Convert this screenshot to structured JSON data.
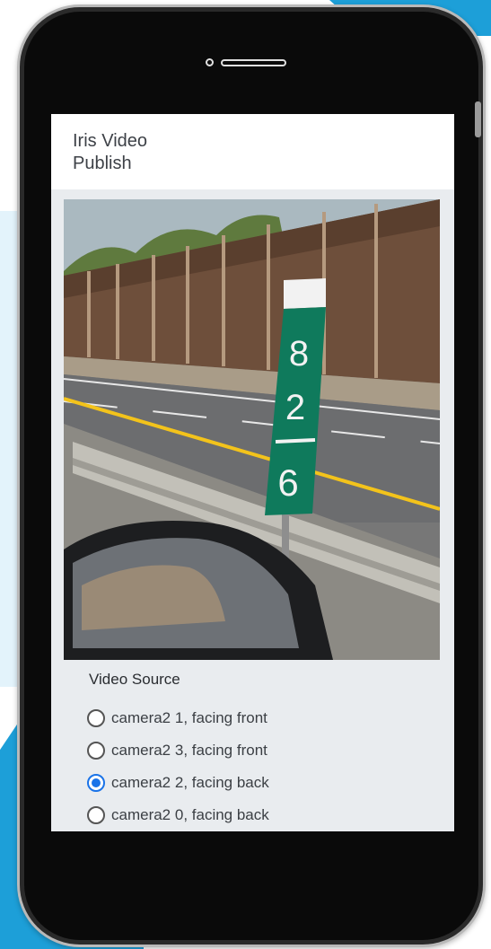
{
  "app": {
    "title": "Iris Video\nPublish"
  },
  "video_source": {
    "heading": "Video Source",
    "options": [
      {
        "label": "camera2 1, facing front",
        "selected": false
      },
      {
        "label": "camera2 3, facing front",
        "selected": false
      },
      {
        "label": "camera2 2, facing back",
        "selected": true
      },
      {
        "label": "camera2 0, facing back",
        "selected": false
      }
    ]
  },
  "preview": {
    "sign_digits": [
      "8",
      "2",
      "6"
    ]
  },
  "colors": {
    "accent": "#1a73e8",
    "background_blue": "#1d9fd8",
    "sign_green": "#0f7a5c"
  }
}
